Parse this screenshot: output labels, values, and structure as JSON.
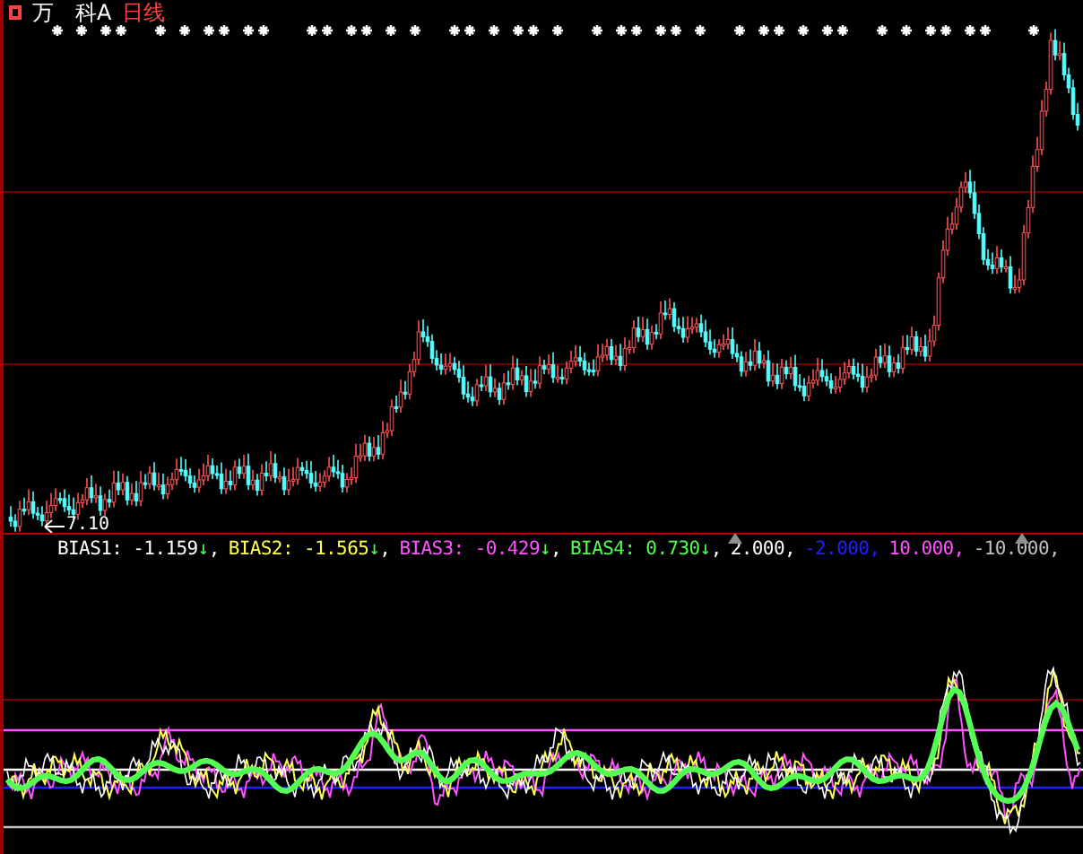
{
  "title": {
    "stock": "万　科A",
    "period": "日线"
  },
  "price_chart": {
    "low_label": "7.10"
  },
  "indicator": {
    "values": [
      {
        "label": "BIAS1:",
        "value": "-1.159",
        "arrow": "↓",
        "separator": ",",
        "color": "#ffffff"
      },
      {
        "label": "BIAS2:",
        "value": "-1.565",
        "arrow": "↓",
        "separator": ",",
        "color": "#ffff54"
      },
      {
        "label": "BIAS3:",
        "value": "-0.429",
        "arrow": "↓",
        "separator": ",",
        "color": "#ff54ff"
      },
      {
        "label": "BIAS4:",
        "value": "0.730",
        "arrow": "↓",
        "separator": ",",
        "color": "#54ff54"
      }
    ],
    "levels": [
      {
        "value": "2.000,",
        "color": "#ffffff"
      },
      {
        "value": "-2.000,",
        "color": "#2020ff"
      },
      {
        "value": "10.000,",
        "color": "#ff54ff"
      },
      {
        "value": "-10.000,",
        "color": "#c0c0c0"
      }
    ]
  }
}
